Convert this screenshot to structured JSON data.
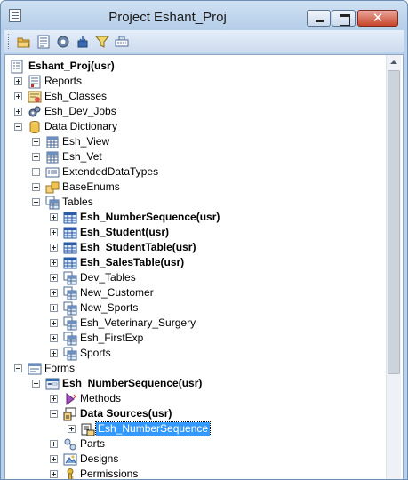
{
  "window": {
    "title": "Project Eshant_Proj"
  },
  "titlebar_buttons": {
    "close_glyph": "✕"
  },
  "toolbar": {
    "icons": [
      "open-icon",
      "properties-icon",
      "compile-icon",
      "import-icon",
      "filter-icon",
      "find-icon"
    ]
  },
  "tree": {
    "root": {
      "label": "Eshant_Proj(usr)"
    },
    "nodes": [
      {
        "label": "Reports",
        "icon": "reports-icon",
        "state": "collapsed",
        "bold": false
      },
      {
        "label": "Esh_Classes",
        "icon": "classes-icon",
        "state": "collapsed",
        "bold": false
      },
      {
        "label": "Esh_Dev_Jobs",
        "icon": "jobs-icon",
        "state": "collapsed",
        "bold": false
      },
      {
        "label": "Data Dictionary",
        "icon": "database-icon",
        "state": "expanded",
        "bold": false
      },
      {
        "label": "Esh_View",
        "icon": "view-icon",
        "state": "collapsed",
        "bold": false
      },
      {
        "label": "Esh_Vet",
        "icon": "view-icon",
        "state": "collapsed",
        "bold": false
      },
      {
        "label": "ExtendedDataTypes",
        "icon": "edt-icon",
        "state": "collapsed",
        "bold": false
      },
      {
        "label": "BaseEnums",
        "icon": "enum-icon",
        "state": "collapsed",
        "bold": false
      },
      {
        "label": "Tables",
        "icon": "tables-icon",
        "state": "expanded",
        "bold": false
      },
      {
        "label": "Esh_NumberSequence(usr)",
        "icon": "table-icon",
        "state": "collapsed",
        "bold": true
      },
      {
        "label": "Esh_Student(usr)",
        "icon": "table-icon",
        "state": "collapsed",
        "bold": true
      },
      {
        "label": "Esh_StudentTable(usr)",
        "icon": "table-icon",
        "state": "collapsed",
        "bold": true
      },
      {
        "label": "Esh_SalesTable(usr)",
        "icon": "table-icon",
        "state": "collapsed",
        "bold": true
      },
      {
        "label": "Dev_Tables",
        "icon": "tables-icon",
        "state": "collapsed",
        "bold": false
      },
      {
        "label": "New_Customer",
        "icon": "tables-icon",
        "state": "collapsed",
        "bold": false
      },
      {
        "label": "New_Sports",
        "icon": "tables-icon",
        "state": "collapsed",
        "bold": false
      },
      {
        "label": "Esh_Veterinary_Surgery",
        "icon": "tables-icon",
        "state": "collapsed",
        "bold": false
      },
      {
        "label": "Esh_FirstExp",
        "icon": "tables-icon",
        "state": "collapsed",
        "bold": false
      },
      {
        "label": "Sports",
        "icon": "tables-icon",
        "state": "collapsed",
        "bold": false
      },
      {
        "label": "Forms",
        "icon": "forms-icon",
        "state": "expanded",
        "bold": false
      },
      {
        "label": "Esh_NumberSequence(usr)",
        "icon": "form-icon",
        "state": "expanded",
        "bold": true
      },
      {
        "label": "Methods",
        "icon": "methods-icon",
        "state": "collapsed",
        "bold": false
      },
      {
        "label": "Data Sources(usr)",
        "icon": "datasources-icon",
        "state": "expanded",
        "bold": true
      },
      {
        "label": "Esh_NumberSequence",
        "icon": "datasource-icon",
        "state": "collapsed",
        "bold": false,
        "selected": true
      },
      {
        "label": "Parts",
        "icon": "parts-icon",
        "state": "collapsed",
        "bold": false
      },
      {
        "label": "Designs",
        "icon": "designs-icon",
        "state": "collapsed",
        "bold": false
      },
      {
        "label": "Permissions",
        "icon": "permissions-icon",
        "state": "collapsed",
        "bold": false
      }
    ]
  },
  "colors": {
    "selection": "#3399ff",
    "frame": "#b9d1ea",
    "close_button": "#c7432b"
  }
}
